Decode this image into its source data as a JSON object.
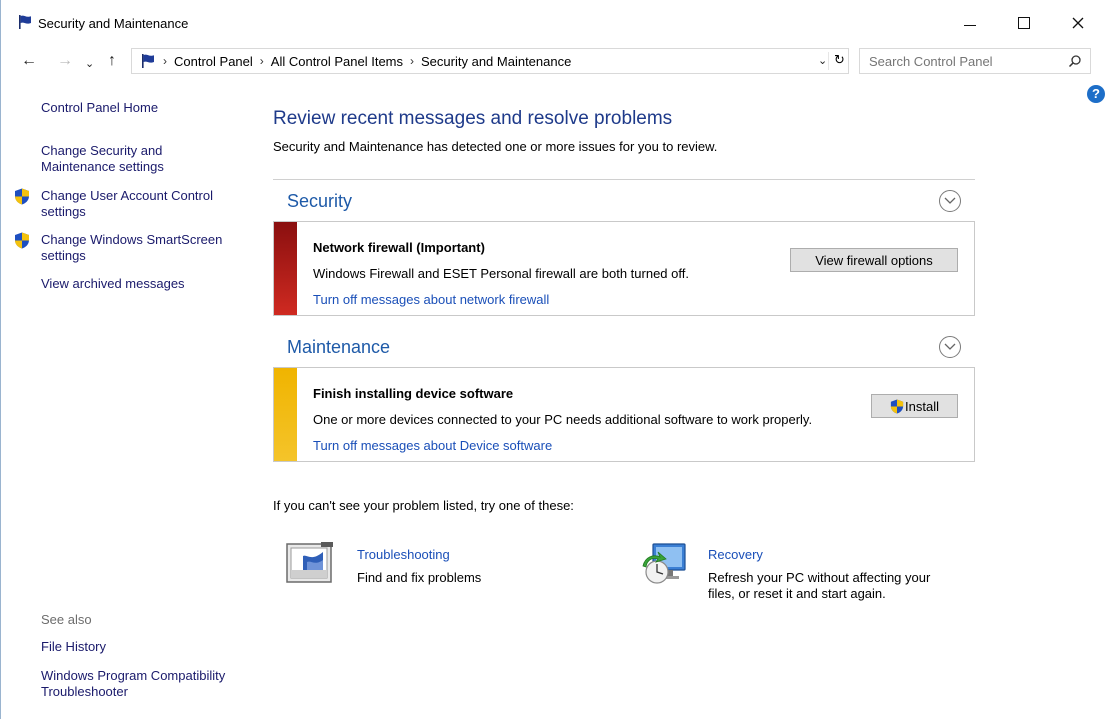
{
  "window": {
    "title": "Security and Maintenance"
  },
  "nav": {
    "back_label": "←",
    "forward_label": "→",
    "recent_label": "⌄",
    "up_label": "↑",
    "breadcrumbs": [
      "Control Panel",
      "All Control Panel Items",
      "Security and Maintenance"
    ],
    "refresh_label": "↻",
    "search_placeholder": "Search Control Panel"
  },
  "sidebar": {
    "items": [
      {
        "label": "Control Panel Home"
      },
      {
        "label": "Change Security and Maintenance settings"
      },
      {
        "label": "Change User Account Control settings"
      },
      {
        "label": "Change Windows SmartScreen settings"
      },
      {
        "label": "View archived messages"
      }
    ],
    "see_also_label": "See also",
    "see_also_items": [
      {
        "label": "File History"
      },
      {
        "label": "Windows Program Compatibility Troubleshooter"
      }
    ]
  },
  "main": {
    "heading": "Review recent messages and resolve problems",
    "subtext": "Security and Maintenance has detected one or more issues for you to review.",
    "security": {
      "title": "Security",
      "card": {
        "title": "Network firewall  (Important)",
        "description": "Windows Firewall and ESET Personal firewall are both turned off.",
        "link": "Turn off messages about network firewall",
        "button": "View firewall options"
      }
    },
    "maintenance": {
      "title": "Maintenance",
      "card": {
        "title": "Finish installing device software",
        "description": "One or more devices connected to your PC needs additional software to work properly.",
        "link": "Turn off messages about Device software",
        "button": "Install"
      }
    },
    "alt_prompt": "If you can't see your problem listed, try one of these:",
    "tools": [
      {
        "title": "Troubleshooting",
        "description": "Find and fix problems"
      },
      {
        "title": "Recovery",
        "description": "Refresh your PC without affecting your files, or reset it and start again."
      }
    ]
  },
  "colors": {
    "link": "#1a4fb8",
    "heading": "#1e3a8a",
    "important_stripe": "#b81c1c",
    "warning_stripe": "#f2b800"
  },
  "icons": [
    "flag-icon",
    "back-arrow-icon",
    "forward-arrow-icon",
    "up-arrow-icon",
    "refresh-icon",
    "search-icon",
    "help-icon",
    "shield-icon",
    "chevron-down-icon",
    "troubleshooting-icon",
    "recovery-icon"
  ]
}
